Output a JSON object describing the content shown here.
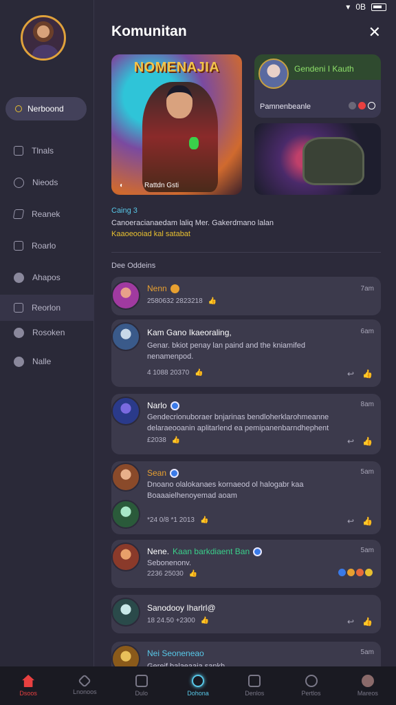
{
  "status_bar": {
    "battery_text": "0B"
  },
  "sidebar": {
    "active_label": "Nerboond",
    "items": [
      {
        "label": "Tlnals",
        "icon": "square-icon"
      },
      {
        "label": "Nieods",
        "icon": "chat-icon"
      },
      {
        "label": "Reanek",
        "icon": "flag-icon"
      },
      {
        "label": "Roarlo",
        "icon": "doc-icon"
      },
      {
        "label": "Ahapos",
        "icon": "globe-icon"
      },
      {
        "label": "Reorlon",
        "icon": "square-icon"
      },
      {
        "label": "Rosoken",
        "icon": "globe-icon"
      },
      {
        "label": "Nalle",
        "icon": "face-icon"
      }
    ]
  },
  "header": {
    "title": "Komunitan",
    "close_label": "✕"
  },
  "featured": {
    "big_card": {
      "logo_text": "NOMENAJIA",
      "caption": "Rattdn Gsti"
    },
    "small_card_1": {
      "title": "Gendeni I Kauth",
      "subtitle": "Pamnenbeanle"
    },
    "small_card_2": {}
  },
  "info": {
    "label": "Caing 3",
    "text": "Canoeracianaedam laliq Mer. Gakerdmano lalan",
    "highlight": "Kaaoeooiad kal satabat"
  },
  "section_label": "Dee Oddeins",
  "posts": [
    {
      "name": "Nenn",
      "time": "7am",
      "body": "",
      "meta": "2580632 2823218",
      "name_color": "#e8a030"
    },
    {
      "name": "Kam Gano Ikaeoraling,",
      "time": "6am",
      "body": "Genar. bkiot penay lan paind and the kniamifed nenamenpod.",
      "meta": "4 1088 20370",
      "name_color": "#ffffff"
    },
    {
      "name": "Narlo",
      "time": "8am",
      "body": "Gendecrionuboraer bnjarinas bendloherklarohmeanne delaraeooanin aplitarlend ea pemipanenbarndhephent",
      "meta": "£2038",
      "name_color": "#ffffff"
    },
    {
      "name": "Sean",
      "time": "5am",
      "body": "Dnoano olalokanaes kornaeod ol halogabr kaa Boaaaielhenoyemad aoam",
      "meta": "*24 0/8 *1 2013",
      "name_color": "#e8a030"
    },
    {
      "name": "Nene.",
      "name_extra": "Kaan barkdiaent Ban",
      "time": "5am",
      "body": "Sebonenonv.",
      "meta": "2236 25030",
      "name_color": "#ffffff"
    },
    {
      "name": "Sanodooy Iharlrl@",
      "time": "",
      "body": "",
      "meta": "18 24.50 +2300",
      "name_color": "#ffffff"
    },
    {
      "name": "Nei Seoneneao",
      "time": "5am",
      "body": "Gereif balaeaaia sankh",
      "meta": "",
      "name_color": "#58c8e8"
    }
  ],
  "bottom_nav": [
    {
      "label": "Dsoos",
      "state": "active-red",
      "icon": "home-icon"
    },
    {
      "label": "Lnonoos",
      "state": "",
      "icon": "diamond-icon"
    },
    {
      "label": "Dulo",
      "state": "",
      "icon": "doc-icon"
    },
    {
      "label": "Dohona",
      "state": "active-cyan",
      "icon": "compass-icon"
    },
    {
      "label": "Denlos",
      "state": "",
      "icon": "calendar-icon"
    },
    {
      "label": "Pertlos",
      "state": "",
      "icon": "bell-icon"
    },
    {
      "label": "Mareos",
      "state": "",
      "icon": "avatar-icon"
    }
  ],
  "colors": {
    "accent_red": "#e84040",
    "accent_cyan": "#58c8e8",
    "gold": "#e8c030"
  }
}
